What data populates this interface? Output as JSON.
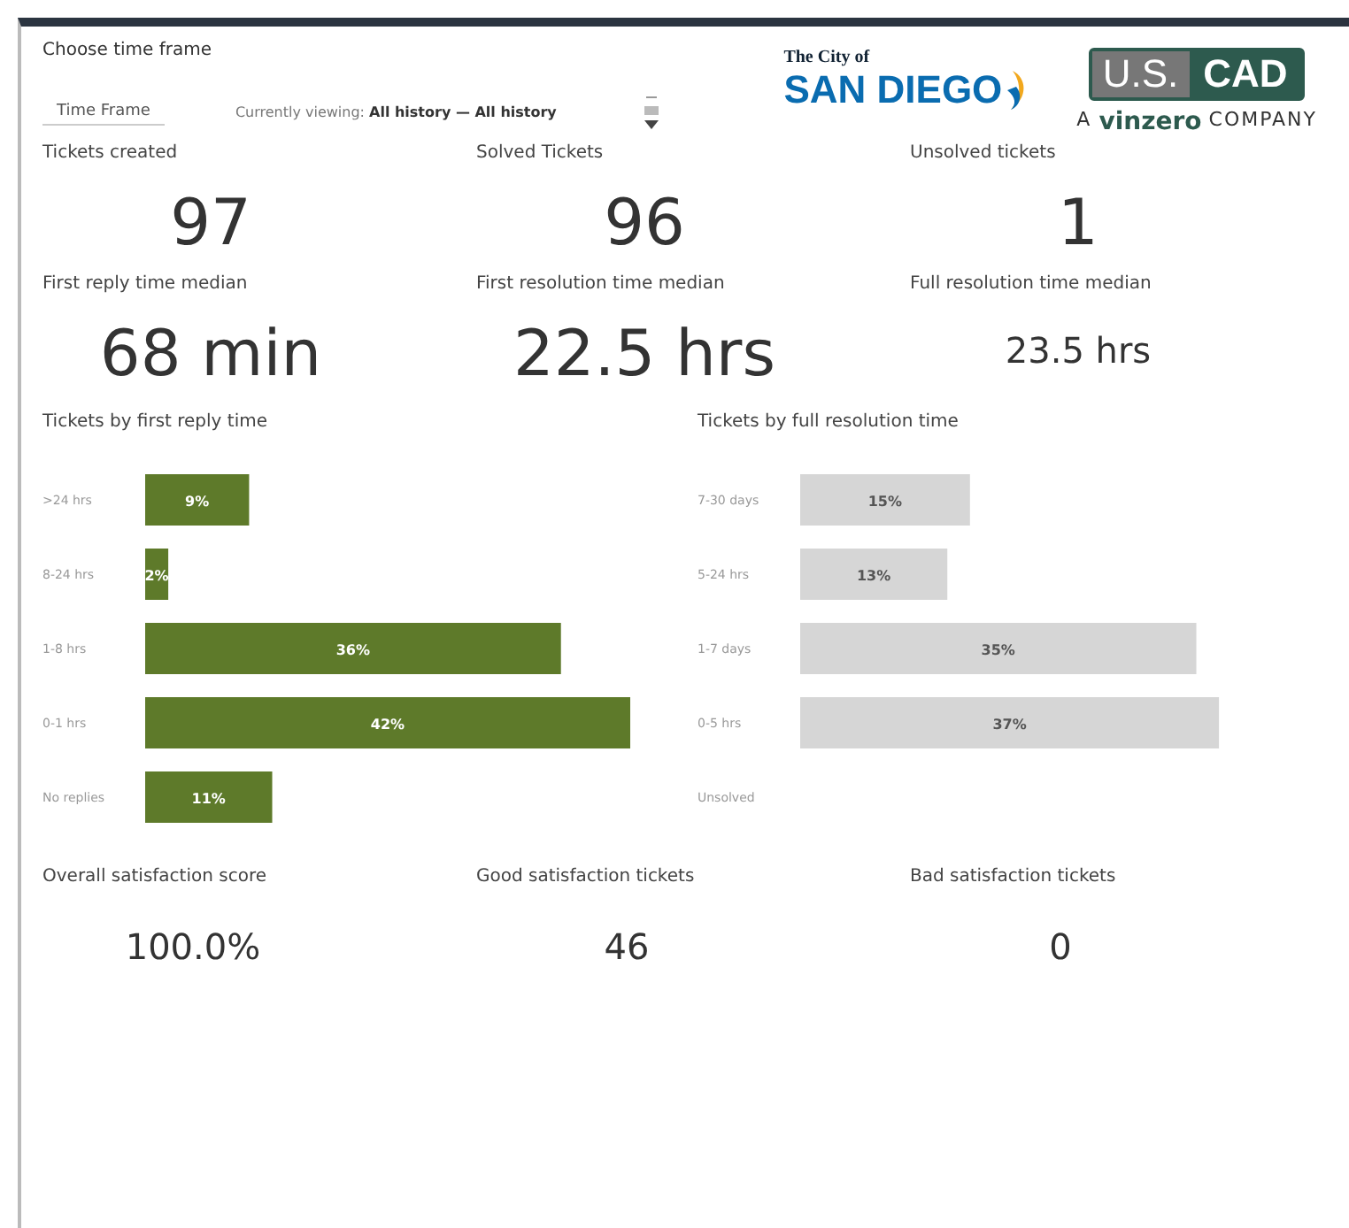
{
  "time_frame": {
    "heading": "Choose time frame",
    "field_label": "Time Frame",
    "viewing_label": "Currently viewing:",
    "viewing_value": "All history — All history"
  },
  "logos": {
    "city_small": "The City of",
    "city_big": "SAN DIEGO",
    "us": "U.S.",
    "cad": "CAD",
    "tagline_a": "A",
    "tagline_brand": "vinzero",
    "tagline_company": "COMPANY"
  },
  "metrics": [
    {
      "label": "Tickets created",
      "value": "97",
      "kind": "headline"
    },
    {
      "label": "Solved Tickets",
      "value": "96",
      "kind": "headline"
    },
    {
      "label": "Unsolved tickets",
      "value": "1",
      "kind": "headline"
    },
    {
      "label": "First reply time median",
      "value": "68 min",
      "kind": "headline"
    },
    {
      "label": "First resolution time median",
      "value": "22.5 hrs",
      "kind": "headline"
    },
    {
      "label": "Full resolution time median",
      "value": "23.5 hrs",
      "kind": "compact"
    }
  ],
  "charts": [
    {
      "title": "Tickets by first reply time",
      "chart_data": {
        "type": "bar",
        "orientation": "horizontal",
        "categories": [
          ">24 hrs",
          "8-24 hrs",
          "1-8 hrs",
          "0-1 hrs",
          "No replies"
        ],
        "series": [
          {
            "color": "#5e7a2a",
            "values": [
              9,
              2,
              36,
              42,
              11
            ],
            "value_labels": [
              "9%",
              "2%",
              "36%",
              "42%",
              "11%"
            ]
          }
        ],
        "data_labels": true
      }
    },
    {
      "title": "Tickets by full resolution time",
      "chart_data": {
        "type": "bar",
        "orientation": "horizontal",
        "categories": [
          "7-30 days",
          "5-24 hrs",
          "1-7 days",
          "0-5 hrs",
          "Unsolved"
        ],
        "series": [
          {
            "color": "#d6d6d6",
            "values": [
              15,
              13,
              35,
              37,
              null
            ],
            "value_labels": [
              "15%",
              "13%",
              "35%",
              "37%",
              null
            ]
          }
        ],
        "data_labels": true
      }
    }
  ],
  "satisfaction": [
    {
      "label": "Overall satisfaction score",
      "value": "100.0%"
    },
    {
      "label": "Good satisfaction tickets",
      "value": "46"
    },
    {
      "label": "Bad satisfaction tickets",
      "value": "0"
    }
  ]
}
